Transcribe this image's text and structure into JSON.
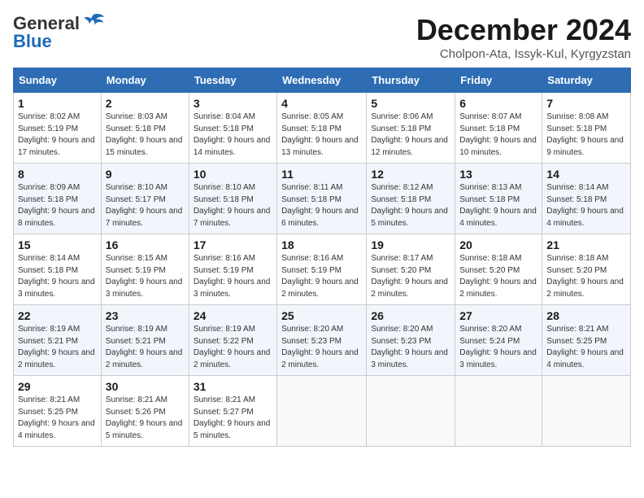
{
  "header": {
    "logo_general": "General",
    "logo_blue": "Blue",
    "month_title": "December 2024",
    "location": "Cholpon-Ata, Issyk-Kul, Kyrgyzstan"
  },
  "days_of_week": [
    "Sunday",
    "Monday",
    "Tuesday",
    "Wednesday",
    "Thursday",
    "Friday",
    "Saturday"
  ],
  "weeks": [
    [
      {
        "day": 1,
        "sunrise": "8:02 AM",
        "sunset": "5:19 PM",
        "daylight": "9 hours and 17 minutes."
      },
      {
        "day": 2,
        "sunrise": "8:03 AM",
        "sunset": "5:18 PM",
        "daylight": "9 hours and 15 minutes."
      },
      {
        "day": 3,
        "sunrise": "8:04 AM",
        "sunset": "5:18 PM",
        "daylight": "9 hours and 14 minutes."
      },
      {
        "day": 4,
        "sunrise": "8:05 AM",
        "sunset": "5:18 PM",
        "daylight": "9 hours and 13 minutes."
      },
      {
        "day": 5,
        "sunrise": "8:06 AM",
        "sunset": "5:18 PM",
        "daylight": "9 hours and 12 minutes."
      },
      {
        "day": 6,
        "sunrise": "8:07 AM",
        "sunset": "5:18 PM",
        "daylight": "9 hours and 10 minutes."
      },
      {
        "day": 7,
        "sunrise": "8:08 AM",
        "sunset": "5:18 PM",
        "daylight": "9 hours and 9 minutes."
      }
    ],
    [
      {
        "day": 8,
        "sunrise": "8:09 AM",
        "sunset": "5:18 PM",
        "daylight": "9 hours and 8 minutes."
      },
      {
        "day": 9,
        "sunrise": "8:10 AM",
        "sunset": "5:17 PM",
        "daylight": "9 hours and 7 minutes."
      },
      {
        "day": 10,
        "sunrise": "8:10 AM",
        "sunset": "5:18 PM",
        "daylight": "9 hours and 7 minutes."
      },
      {
        "day": 11,
        "sunrise": "8:11 AM",
        "sunset": "5:18 PM",
        "daylight": "9 hours and 6 minutes."
      },
      {
        "day": 12,
        "sunrise": "8:12 AM",
        "sunset": "5:18 PM",
        "daylight": "9 hours and 5 minutes."
      },
      {
        "day": 13,
        "sunrise": "8:13 AM",
        "sunset": "5:18 PM",
        "daylight": "9 hours and 4 minutes."
      },
      {
        "day": 14,
        "sunrise": "8:14 AM",
        "sunset": "5:18 PM",
        "daylight": "9 hours and 4 minutes."
      }
    ],
    [
      {
        "day": 15,
        "sunrise": "8:14 AM",
        "sunset": "5:18 PM",
        "daylight": "9 hours and 3 minutes."
      },
      {
        "day": 16,
        "sunrise": "8:15 AM",
        "sunset": "5:19 PM",
        "daylight": "9 hours and 3 minutes."
      },
      {
        "day": 17,
        "sunrise": "8:16 AM",
        "sunset": "5:19 PM",
        "daylight": "9 hours and 3 minutes."
      },
      {
        "day": 18,
        "sunrise": "8:16 AM",
        "sunset": "5:19 PM",
        "daylight": "9 hours and 2 minutes."
      },
      {
        "day": 19,
        "sunrise": "8:17 AM",
        "sunset": "5:20 PM",
        "daylight": "9 hours and 2 minutes."
      },
      {
        "day": 20,
        "sunrise": "8:18 AM",
        "sunset": "5:20 PM",
        "daylight": "9 hours and 2 minutes."
      },
      {
        "day": 21,
        "sunrise": "8:18 AM",
        "sunset": "5:20 PM",
        "daylight": "9 hours and 2 minutes."
      }
    ],
    [
      {
        "day": 22,
        "sunrise": "8:19 AM",
        "sunset": "5:21 PM",
        "daylight": "9 hours and 2 minutes."
      },
      {
        "day": 23,
        "sunrise": "8:19 AM",
        "sunset": "5:21 PM",
        "daylight": "9 hours and 2 minutes."
      },
      {
        "day": 24,
        "sunrise": "8:19 AM",
        "sunset": "5:22 PM",
        "daylight": "9 hours and 2 minutes."
      },
      {
        "day": 25,
        "sunrise": "8:20 AM",
        "sunset": "5:23 PM",
        "daylight": "9 hours and 2 minutes."
      },
      {
        "day": 26,
        "sunrise": "8:20 AM",
        "sunset": "5:23 PM",
        "daylight": "9 hours and 3 minutes."
      },
      {
        "day": 27,
        "sunrise": "8:20 AM",
        "sunset": "5:24 PM",
        "daylight": "9 hours and 3 minutes."
      },
      {
        "day": 28,
        "sunrise": "8:21 AM",
        "sunset": "5:25 PM",
        "daylight": "9 hours and 4 minutes."
      }
    ],
    [
      {
        "day": 29,
        "sunrise": "8:21 AM",
        "sunset": "5:25 PM",
        "daylight": "9 hours and 4 minutes."
      },
      {
        "day": 30,
        "sunrise": "8:21 AM",
        "sunset": "5:26 PM",
        "daylight": "9 hours and 5 minutes."
      },
      {
        "day": 31,
        "sunrise": "8:21 AM",
        "sunset": "5:27 PM",
        "daylight": "9 hours and 5 minutes."
      },
      null,
      null,
      null,
      null
    ]
  ]
}
